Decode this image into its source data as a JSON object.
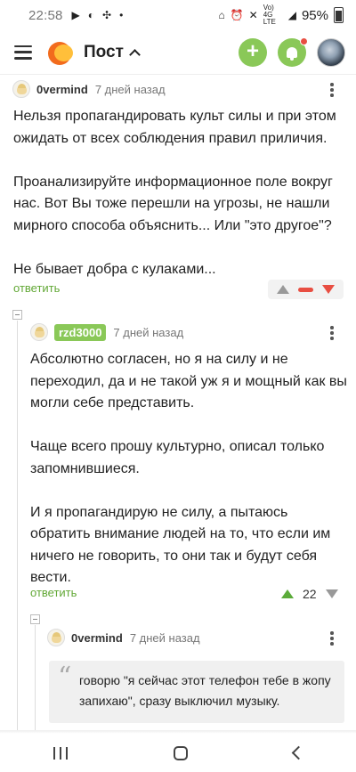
{
  "status_bar": {
    "time": "22:58",
    "battery": "95%",
    "net_label": "Vo) 4G LTE"
  },
  "header": {
    "title": "Пост"
  },
  "comments": [
    {
      "author": "0vermind",
      "time": "7 дней назад",
      "paragraphs": [
        "Нельзя пропагандировать культ силы и при этом ожидать от всех соблюдения правил приличия.",
        "Проанализируйте информационное поле вокруг нас. Вот Вы тоже перешли на угрозы, не нашли мирного способа объяснить... Или \"это другое\"?",
        "Не бывает добра с кулаками..."
      ],
      "reply_label": "ответить"
    },
    {
      "author": "rzd3000",
      "time": "7 дней назад",
      "paragraphs": [
        "Абсолютно согласен, но я на силу и не переходил, да и не такой уж я и мощный как вы могли себе представить.",
        "Чаще всего прошу культурно, описал только запомнившиеся.",
        "И я пропагандирую не силу, а пытаюсь обратить внимание людей на то, что если им ничего не говорить, то они так и будут себя вести."
      ],
      "reply_label": "ответить",
      "rating": "22"
    },
    {
      "author": "0vermind",
      "time": "7 дней назад",
      "quote": "говорю \"я сейчас этот телефон тебе в жопу запихаю\", сразу выключил музыку."
    }
  ]
}
